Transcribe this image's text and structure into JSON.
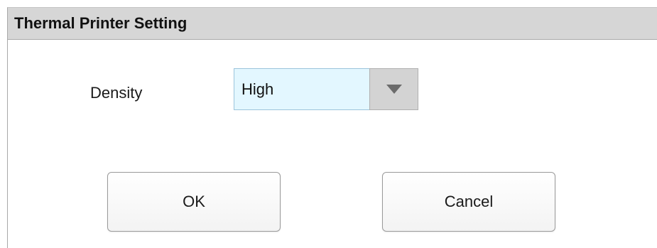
{
  "dialog": {
    "title": "Thermal Printer Setting"
  },
  "density": {
    "label": "Density",
    "selected": "High",
    "arrow_icon": "triangle-down-icon"
  },
  "buttons": {
    "ok_label": "OK",
    "cancel_label": "Cancel"
  },
  "colors": {
    "title_bar": "#d6d6d6",
    "select_background": "#e3f7ff",
    "select_arrow_background": "#d3d3d3"
  }
}
